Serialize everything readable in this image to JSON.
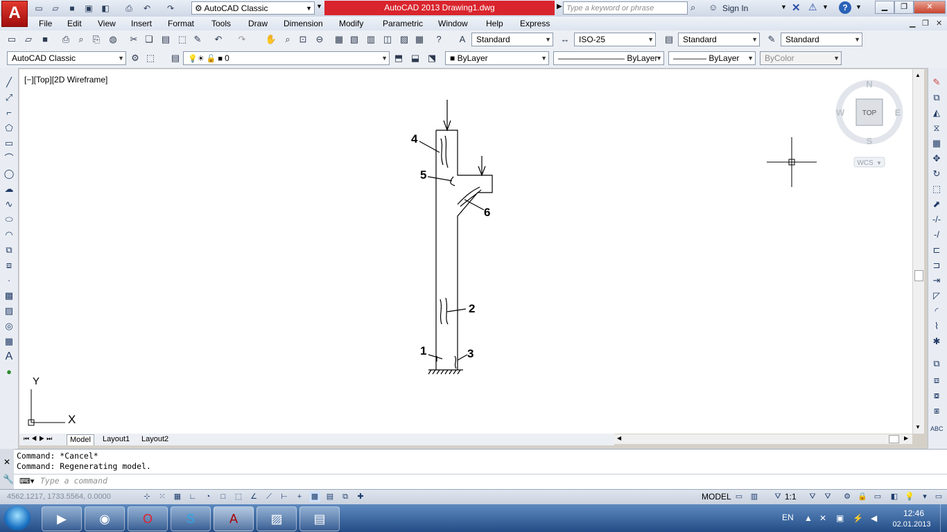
{
  "title_bar": {
    "workspace": "AutoCAD Classic",
    "title": "AutoCAD 2013    Drawing1.dwg",
    "search_placeholder": "Type a keyword or phrase",
    "sign_in": "Sign In"
  },
  "menu": [
    "File",
    "Edit",
    "View",
    "Insert",
    "Format",
    "Tools",
    "Draw",
    "Dimension",
    "Modify",
    "Parametric",
    "Window",
    "Help",
    "Express"
  ],
  "toolbar1": {
    "text_style": "Standard",
    "dim_style": "ISO-25",
    "table_style": "Standard",
    "mleader_style": "Standard"
  },
  "toolbar2": {
    "workspace": "AutoCAD Classic",
    "layer": "0",
    "color": "ByLayer",
    "linetype": "ByLayer",
    "lineweight": "ByLayer",
    "plotstyle": "ByColor"
  },
  "viewport": {
    "label": "[−][Top][2D Wireframe]",
    "viewcube": {
      "north": "N",
      "south": "S",
      "east": "E",
      "west": "W",
      "top": "TOP",
      "wcs": "WCS"
    },
    "ucs": {
      "x": "X",
      "y": "Y"
    }
  },
  "drawing_labels": [
    "1",
    "2",
    "3",
    "4",
    "5",
    "6"
  ],
  "tabs": [
    "Model",
    "Layout1",
    "Layout2"
  ],
  "command": {
    "history": [
      "Command: *Cancel*",
      "Command:  Regenerating model."
    ],
    "prompt": "Type a command"
  },
  "status": {
    "coords": "4562.1217, 1733.5564, 0.0000",
    "model": "MODEL",
    "scale": "1:1"
  },
  "taskbar": {
    "lang": "EN",
    "time": "12:46",
    "date": "02.01.2013"
  },
  "colors": {
    "title_banner": "#d9242d",
    "taskbar": "#244c86",
    "canvas": "#ffffff"
  }
}
